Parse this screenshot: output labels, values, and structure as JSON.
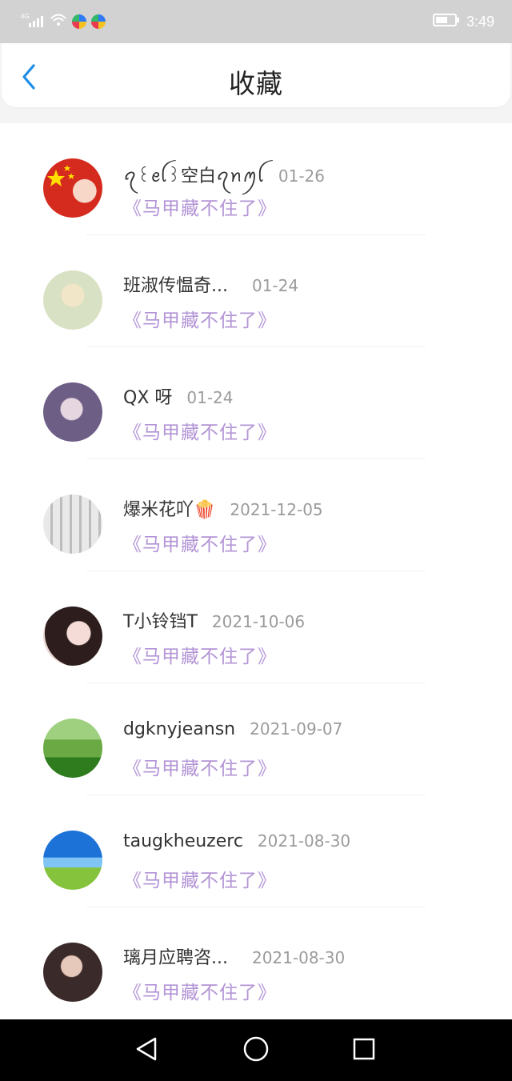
{
  "status_bar": {
    "network": "4G",
    "time": "3:49"
  },
  "header": {
    "title": "收藏",
    "back_icon": "chevron-left-icon",
    "back_color": "#1a8ee8"
  },
  "list": [
    {
      "name": "ꪖ꒰ꫀꪶ꒱空白ꪖꪀꪑꪶ",
      "date": "01-26",
      "title": "《马甲藏不住了》"
    },
    {
      "name": "班淑传愠奇...",
      "date": "01-24",
      "title": "《马甲藏不住了》"
    },
    {
      "name": "QX 呀",
      "date": "01-24",
      "title": "《马甲藏不住了》"
    },
    {
      "name": "爆米花吖🍿",
      "date": "2021-12-05",
      "title": "《马甲藏不住了》"
    },
    {
      "name": "T小铃铛T",
      "date": "2021-10-06",
      "title": "《马甲藏不住了》"
    },
    {
      "name": "dgknyjeansn",
      "date": "2021-09-07",
      "title": "《马甲藏不住了》"
    },
    {
      "name": "taugkheuzerc",
      "date": "2021-08-30",
      "title": "《马甲藏不住了》"
    },
    {
      "name": "璃月应聘咨...",
      "date": "2021-08-30",
      "title": "《马甲藏不住了》"
    }
  ],
  "colors": {
    "title_purple": "#b394d6",
    "date_gray": "#9b9b9b",
    "name_dark": "#333333"
  },
  "nav": {
    "back_icon": "triangle-back-icon",
    "home_icon": "circle-home-icon",
    "recents_icon": "square-recents-icon"
  }
}
